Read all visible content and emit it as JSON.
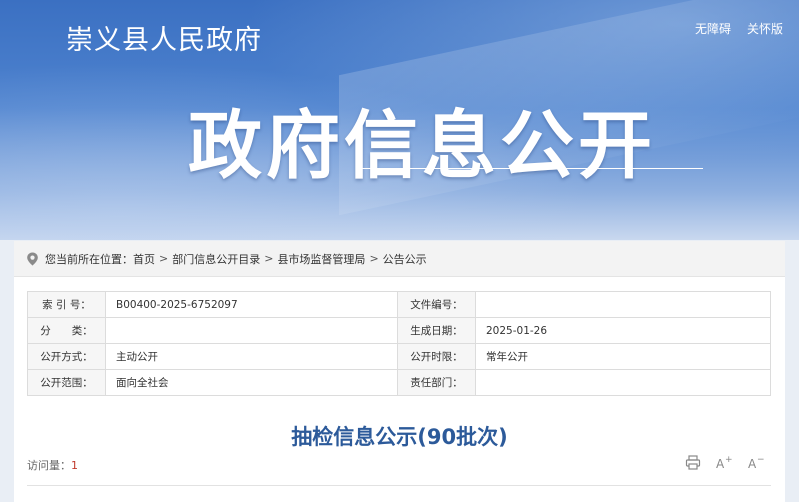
{
  "header": {
    "site_title": "崇义县人民政府",
    "links": [
      "无障碍",
      "关怀版"
    ],
    "hero_title": "政府信息公开"
  },
  "breadcrumb": {
    "prefix": "您当前所在位置：",
    "items": [
      "首页",
      "部门信息公开目录",
      "县市场监督管理局",
      "公告公示"
    ],
    "separator": ">"
  },
  "meta": {
    "rows": [
      [
        {
          "label": "索 引 号：",
          "value": "B00400-2025-6752097"
        },
        {
          "label": "文件编号：",
          "value": ""
        }
      ],
      [
        {
          "label": "分　　类：",
          "value": ""
        },
        {
          "label": "生成日期：",
          "value": "2025-01-26"
        }
      ],
      [
        {
          "label": "公开方式：",
          "value": "主动公开"
        },
        {
          "label": "公开时限：",
          "value": "常年公开"
        }
      ],
      [
        {
          "label": "公开范围：",
          "value": "面向全社会"
        },
        {
          "label": "责任部门：",
          "value": ""
        }
      ]
    ]
  },
  "article": {
    "title": "抽检信息公示(90批次)",
    "visits_label": "访问量：",
    "visits_count": "1"
  },
  "tools": {
    "icons": [
      "print-icon",
      "font-increase-icon",
      "font-decrease-icon"
    ],
    "enlarge_glyph": "A",
    "enlarge_mark": "+",
    "shrink_glyph": "A",
    "shrink_mark": "−"
  },
  "colors": {
    "banner_blue": "#3b70c2",
    "title_blue": "#2c5a9a",
    "count_red": "#c0392b"
  }
}
